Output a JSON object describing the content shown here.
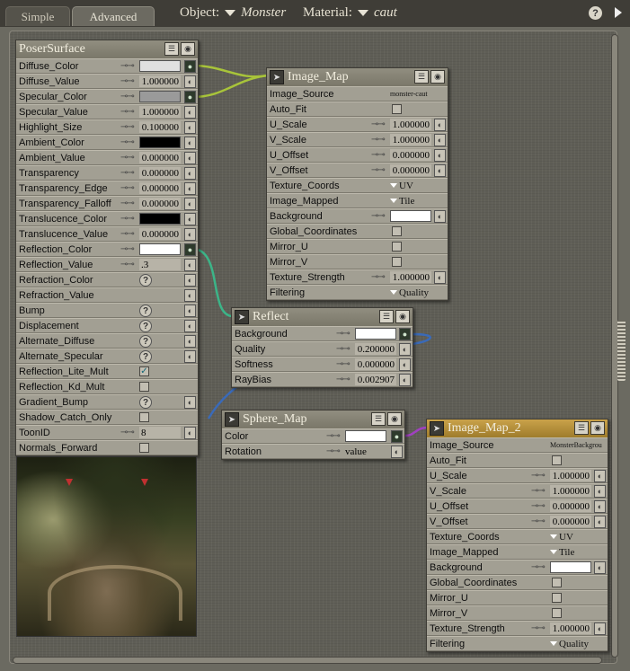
{
  "tabs": {
    "simple": "Simple",
    "advanced": "Advanced"
  },
  "header": {
    "object_label": "Object:",
    "object_value": "Monster",
    "material_label": "Material:",
    "material_value": "caut",
    "help": "?"
  },
  "poser": {
    "title": "PoserSurface",
    "rows": [
      {
        "label": "Diffuse_Color",
        "kind": "color",
        "color": "#e0e0e0",
        "conn": true
      },
      {
        "label": "Diffuse_Value",
        "kind": "num",
        "value": "1.000000"
      },
      {
        "label": "Specular_Color",
        "kind": "color",
        "color": "#9a9a9a",
        "conn": true
      },
      {
        "label": "Specular_Value",
        "kind": "num",
        "value": "1.000000"
      },
      {
        "label": "Highlight_Size",
        "kind": "num",
        "value": "0.100000"
      },
      {
        "label": "Ambient_Color",
        "kind": "color",
        "color": "#000000"
      },
      {
        "label": "Ambient_Value",
        "kind": "num",
        "value": "0.000000"
      },
      {
        "label": "Transparency",
        "kind": "num",
        "value": "0.000000"
      },
      {
        "label": "Transparency_Edge",
        "kind": "num",
        "value": "0.000000"
      },
      {
        "label": "Transparency_Falloff",
        "kind": "num",
        "value": "0.000000"
      },
      {
        "label": "Translucence_Color",
        "kind": "color",
        "color": "#000000"
      },
      {
        "label": "Translucence_Value",
        "kind": "num",
        "value": "0.000000"
      },
      {
        "label": "Reflection_Color",
        "kind": "color",
        "color": "#ffffff",
        "conn": true
      },
      {
        "label": "Reflection_Value",
        "kind": "num",
        "value": ".3"
      },
      {
        "label": "Refraction_Color",
        "kind": "q"
      },
      {
        "label": "Refraction_Value",
        "kind": "plug"
      },
      {
        "label": "Bump",
        "kind": "q"
      },
      {
        "label": "Displacement",
        "kind": "q"
      },
      {
        "label": "Alternate_Diffuse",
        "kind": "q"
      },
      {
        "label": "Alternate_Specular",
        "kind": "q"
      },
      {
        "label": "Reflection_Lite_Mult",
        "kind": "check",
        "checked": true
      },
      {
        "label": "Reflection_Kd_Mult",
        "kind": "check",
        "checked": false
      },
      {
        "label": "Gradient_Bump",
        "kind": "q"
      },
      {
        "label": "Shadow_Catch_Only",
        "kind": "check",
        "checked": false
      },
      {
        "label": "ToonID",
        "kind": "num",
        "value": "8"
      },
      {
        "label": "Normals_Forward",
        "kind": "check",
        "checked": false
      }
    ]
  },
  "image_map": {
    "title": "Image_Map",
    "rows": [
      {
        "label": "Image_Source",
        "kind": "text",
        "value": "monster-caut"
      },
      {
        "label": "Auto_Fit",
        "kind": "check",
        "checked": false
      },
      {
        "label": "U_Scale",
        "kind": "num",
        "value": "1.000000"
      },
      {
        "label": "V_Scale",
        "kind": "num",
        "value": "1.000000"
      },
      {
        "label": "U_Offset",
        "kind": "num",
        "value": "0.000000"
      },
      {
        "label": "V_Offset",
        "kind": "num",
        "value": "0.000000"
      },
      {
        "label": "Texture_Coords",
        "kind": "dd",
        "value": "UV"
      },
      {
        "label": "Image_Mapped",
        "kind": "dd",
        "value": "Tile"
      },
      {
        "label": "Background",
        "kind": "color",
        "color": "#ffffff"
      },
      {
        "label": "Global_Coordinates",
        "kind": "check",
        "checked": false
      },
      {
        "label": "Mirror_U",
        "kind": "check",
        "checked": false
      },
      {
        "label": "Mirror_V",
        "kind": "check",
        "checked": false
      },
      {
        "label": "Texture_Strength",
        "kind": "num",
        "value": "1.000000"
      },
      {
        "label": "Filtering",
        "kind": "dd",
        "value": "Quality"
      }
    ]
  },
  "reflect": {
    "title": "Reflect",
    "rows": [
      {
        "label": "Background",
        "kind": "color",
        "color": "#ffffff",
        "conn": true
      },
      {
        "label": "Quality",
        "kind": "num",
        "value": "0.200000"
      },
      {
        "label": "Softness",
        "kind": "num",
        "value": "0.000000"
      },
      {
        "label": "RayBias",
        "kind": "num",
        "value": "0.002907"
      }
    ]
  },
  "sphere": {
    "title": "Sphere_Map",
    "rows": [
      {
        "label": "Color",
        "kind": "color",
        "color": "#ffffff",
        "conn": true
      },
      {
        "label": "Rotation",
        "kind": "num",
        "value": "value"
      }
    ]
  },
  "image_map2": {
    "title": "Image_Map_2",
    "rows": [
      {
        "label": "Image_Source",
        "kind": "text",
        "value": "MonsterBackgrou"
      },
      {
        "label": "Auto_Fit",
        "kind": "check",
        "checked": false
      },
      {
        "label": "U_Scale",
        "kind": "num",
        "value": "1.000000"
      },
      {
        "label": "V_Scale",
        "kind": "num",
        "value": "1.000000"
      },
      {
        "label": "U_Offset",
        "kind": "num",
        "value": "0.000000"
      },
      {
        "label": "V_Offset",
        "kind": "num",
        "value": "0.000000"
      },
      {
        "label": "Texture_Coords",
        "kind": "dd",
        "value": "UV"
      },
      {
        "label": "Image_Mapped",
        "kind": "dd",
        "value": "Tile"
      },
      {
        "label": "Background",
        "kind": "color",
        "color": "#ffffff"
      },
      {
        "label": "Global_Coordinates",
        "kind": "check",
        "checked": false
      },
      {
        "label": "Mirror_U",
        "kind": "check",
        "checked": false
      },
      {
        "label": "Mirror_V",
        "kind": "check",
        "checked": false
      },
      {
        "label": "Texture_Strength",
        "kind": "num",
        "value": "1.000000"
      },
      {
        "label": "Filtering",
        "kind": "dd",
        "value": "Quality"
      }
    ]
  },
  "wire_colors": {
    "green": "#a8c43a",
    "teal": "#3cb488",
    "blue": "#3a6ab8",
    "purple": "#a040c0"
  }
}
